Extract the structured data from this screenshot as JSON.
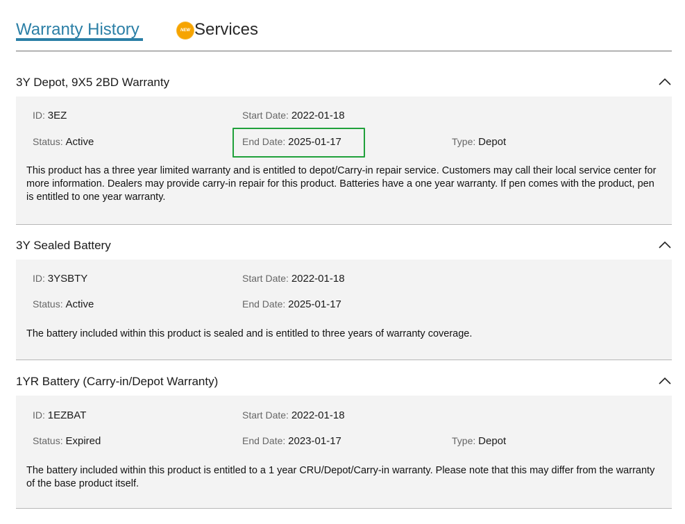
{
  "tabs": {
    "warranty_history": "Warranty History",
    "services_badge": "NEW",
    "services": "Services"
  },
  "labels": {
    "id": "ID",
    "status": "Status",
    "start_date": "Start Date",
    "end_date": "End Date",
    "type": "Type"
  },
  "warranties": [
    {
      "title": "3Y Depot, 9X5 2BD Warranty",
      "id": "3EZ",
      "status": "Active",
      "start_date": "2022-01-18",
      "end_date": "2025-01-17",
      "type": "Depot",
      "description": "This product has a three year limited warranty and is entitled to depot/Carry-in repair service. Customers may call their local service center for more information. Dealers may provide carry-in repair for this product. Batteries have a one year warranty. If pen comes with the product, pen is entitled to one year warranty."
    },
    {
      "title": "3Y Sealed Battery",
      "id": "3YSBTY",
      "status": "Active",
      "start_date": "2022-01-18",
      "end_date": "2025-01-17",
      "description": "The battery included within this product is sealed and is entitled to three years of warranty coverage."
    },
    {
      "title": "1YR Battery (Carry-in/Depot Warranty)",
      "id": "1EZBAT",
      "status": "Expired",
      "start_date": "2022-01-18",
      "end_date": "2023-01-17",
      "type": "Depot",
      "description": "The battery included within this product is entitled to a 1 year CRU/Depot/Carry-in warranty. Please note that this may differ from the warranty of the base product itself."
    }
  ],
  "colors": {
    "accent": "#2b7fa6",
    "badge": "#f6a400",
    "highlight": "#1fa03a",
    "panel": "#f3f3f3"
  }
}
